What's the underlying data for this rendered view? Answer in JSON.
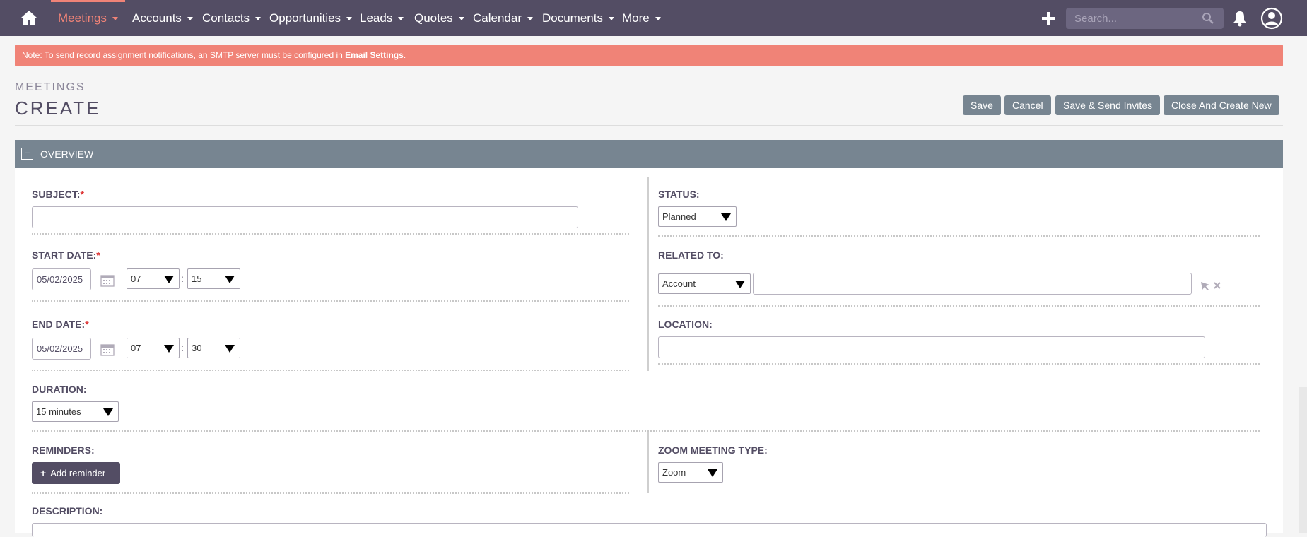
{
  "nav": {
    "items": [
      {
        "label": "Meetings",
        "active": true
      },
      {
        "label": "Accounts"
      },
      {
        "label": "Contacts"
      },
      {
        "label": "Opportunities"
      },
      {
        "label": "Leads"
      },
      {
        "label": "Quotes"
      },
      {
        "label": "Calendar"
      },
      {
        "label": "Documents"
      },
      {
        "label": "More"
      }
    ],
    "search_placeholder": "Search...",
    "icons": [
      "home-icon",
      "plus-icon",
      "search-icon",
      "bell-icon",
      "user-icon"
    ]
  },
  "alert": {
    "text": "Note: To send record assignment notifications, an SMTP server must be configured in ",
    "link": "Email Settings",
    "suffix": "."
  },
  "header": {
    "module": "MEETINGS",
    "title": "CREATE",
    "buttons": {
      "save": "Save",
      "cancel": "Cancel",
      "save_send": "Save & Send Invites",
      "close_create": "Close And Create New"
    }
  },
  "panel": {
    "toggle": "−",
    "title": "OVERVIEW"
  },
  "form": {
    "subject": {
      "label": "SUBJECT:",
      "required": "*",
      "value": ""
    },
    "status": {
      "label": "STATUS:",
      "value": "Planned"
    },
    "start_date": {
      "label": "START DATE:",
      "required": "*",
      "date": "05/02/2025",
      "hour": "07",
      "minute": "15"
    },
    "related_to": {
      "label": "RELATED TO:",
      "type": "Account",
      "value": ""
    },
    "end_date": {
      "label": "END DATE:",
      "required": "*",
      "date": "05/02/2025",
      "hour": "07",
      "minute": "30"
    },
    "location": {
      "label": "LOCATION:",
      "value": ""
    },
    "duration": {
      "label": "DURATION:",
      "value": "15 minutes"
    },
    "reminders": {
      "label": "REMINDERS:",
      "button": "Add reminder",
      "button_icon": "+"
    },
    "zoom": {
      "label": "ZOOM MEETING TYPE:",
      "value": "Zoom"
    },
    "description": {
      "label": "DESCRIPTION:"
    },
    "time_separator": ":"
  },
  "colors": {
    "nav_bg": "#534d64",
    "accent": "#f08377",
    "panel_header": "#778591",
    "button": "#778591"
  }
}
